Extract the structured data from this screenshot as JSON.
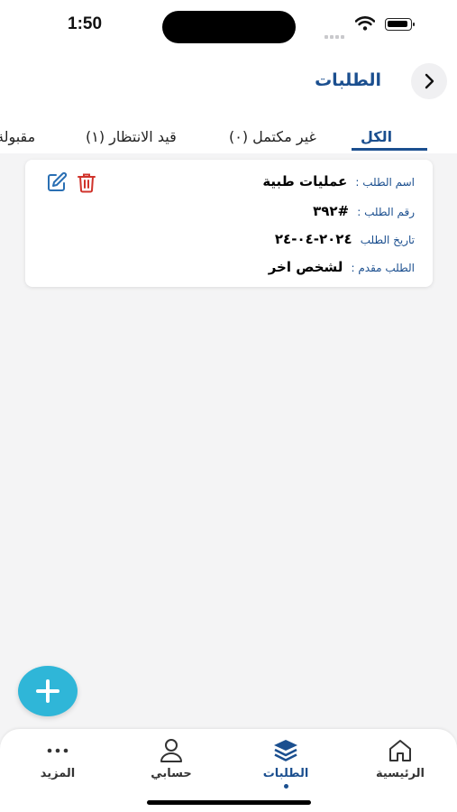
{
  "status": {
    "time": "1:50"
  },
  "header": {
    "title": "الطلبات",
    "back_icon": "chevron-right-icon"
  },
  "tabs": [
    {
      "label": "الكل",
      "active": true
    },
    {
      "label": "غير مكتمل (٠)",
      "active": false
    },
    {
      "label": "قيد الانتظار (١)",
      "active": false
    },
    {
      "label": "مقبولة",
      "active": false
    }
  ],
  "request": {
    "name_label": "اسم الطلب :",
    "name_value": "عمليات طبية",
    "number_label": "رقم الطلب :",
    "number_value": "#٣٩٢",
    "date_label": "تاريخ الطلب",
    "date_value": "٢٠٢٤-٠٤-٢٤",
    "submitted_label": "الطلب مقدم :",
    "submitted_value": "لشخص اخر"
  },
  "fab": {
    "icon": "plus-icon"
  },
  "tabbar": {
    "items": [
      {
        "label": "الرئيسية",
        "icon": "home-icon"
      },
      {
        "label": "الطلبات",
        "icon": "layers-icon",
        "active": true
      },
      {
        "label": "حسابي",
        "icon": "user-icon"
      },
      {
        "label": "المزيد",
        "icon": "more-icon"
      }
    ]
  },
  "colors": {
    "primary": "#1b4f8f",
    "fab": "#2fb6d8",
    "delete": "#d0332b",
    "edit": "#2a6fb3",
    "background": "#f4f4f5"
  }
}
